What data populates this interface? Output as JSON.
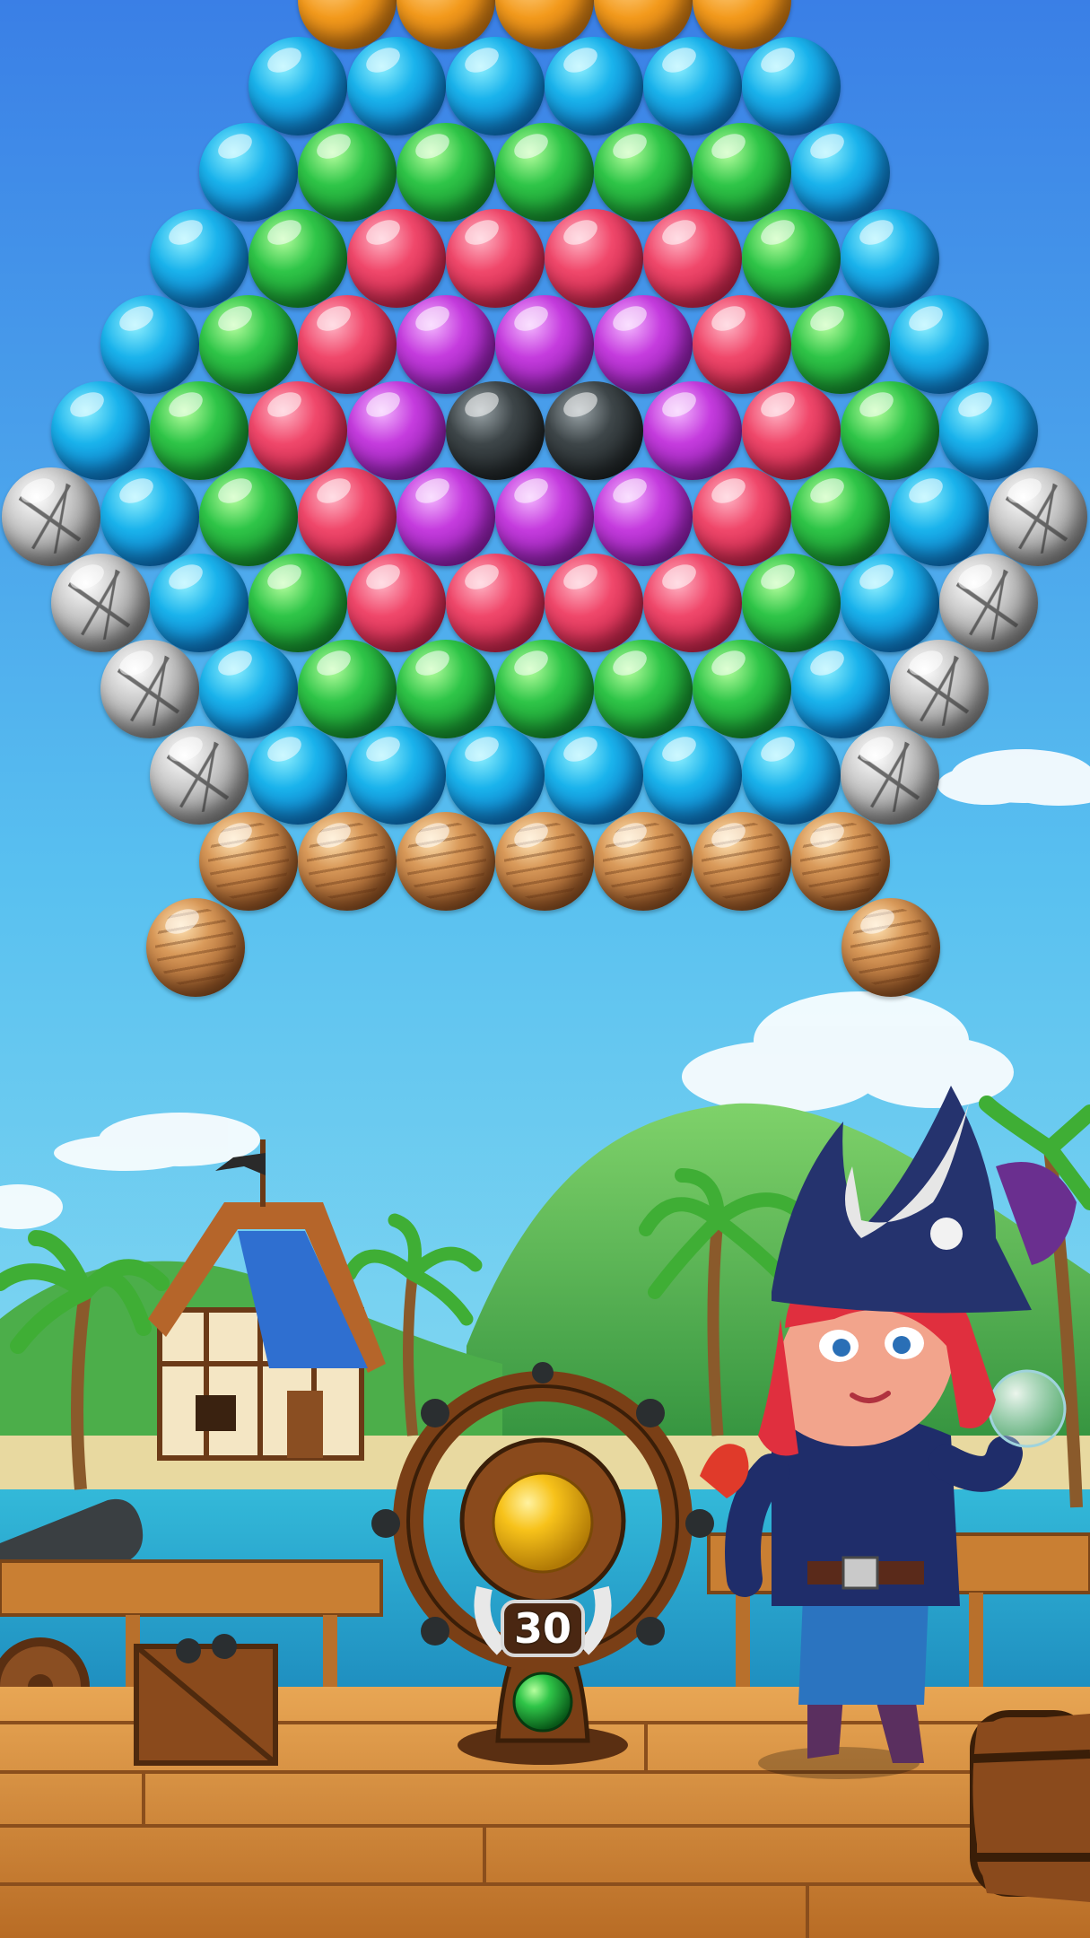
{
  "game": {
    "shots_remaining": "30",
    "current_bubble": "yellow",
    "next_bubble": "green"
  },
  "bubble_colors": {
    "blue": "#1ab3ec",
    "green": "#2fc548",
    "red": "#f0486b",
    "purple": "#c53cde",
    "black": "#3e4649",
    "stone": "#c9c9c9",
    "wood": "#b06a34",
    "yellow": "#f7c21a"
  },
  "bubble_grid": [
    [
      "orange",
      "orange",
      "orange",
      "orange",
      "orange"
    ],
    [
      "blue",
      "blue",
      "blue",
      "blue",
      "blue",
      "blue"
    ],
    [
      "blue",
      "green",
      "green",
      "green",
      "green",
      "green",
      "blue"
    ],
    [
      "blue",
      "green",
      "red",
      "red",
      "red",
      "red",
      "green",
      "blue"
    ],
    [
      "blue",
      "green",
      "red",
      "purple",
      "purple",
      "purple",
      "red",
      "green",
      "blue"
    ],
    [
      "blue",
      "green",
      "red",
      "purple",
      "black",
      "black",
      "purple",
      "red",
      "green",
      "blue"
    ],
    [
      "stone",
      "blue",
      "green",
      "red",
      "purple",
      "purple",
      "purple",
      "red",
      "green",
      "blue",
      "stone"
    ],
    [
      "stone",
      "blue",
      "green",
      "red",
      "red",
      "red",
      "red",
      "green",
      "blue",
      "stone"
    ],
    [
      "stone",
      "blue",
      "green",
      "green",
      "green",
      "green",
      "green",
      "blue",
      "stone"
    ],
    [
      "stone",
      "blue",
      "blue",
      "blue",
      "blue",
      "blue",
      "blue",
      "stone"
    ],
    [
      "wood",
      "wood",
      "wood",
      "wood",
      "wood",
      "wood",
      "wood"
    ],
    [
      "wood",
      "wood"
    ]
  ],
  "scene": {
    "sky_top": "#3a7fe6",
    "sky_bottom": "#8fe6f2",
    "deck": "#d8913f",
    "character": "pirate-girl",
    "launcher": "ship-wheel"
  }
}
